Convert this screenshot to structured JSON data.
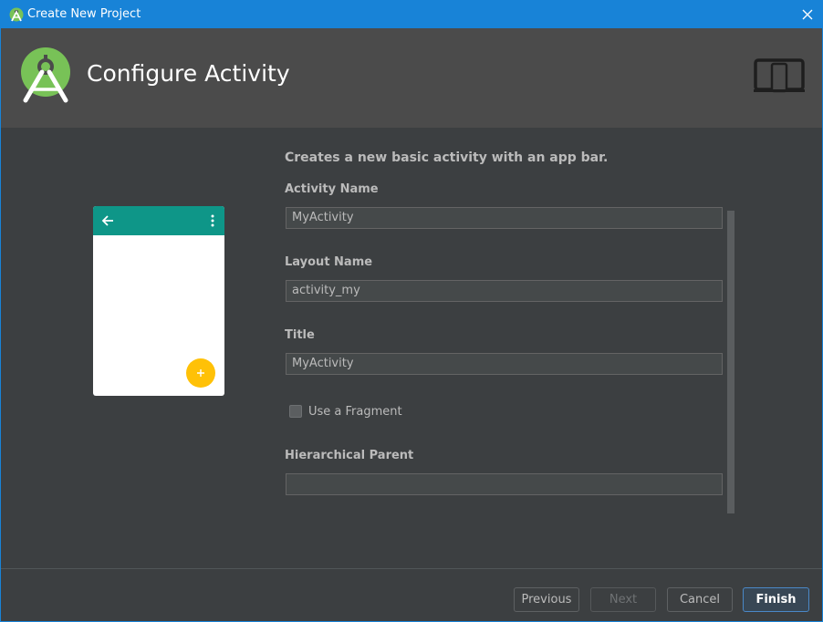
{
  "window": {
    "title": "Create New Project"
  },
  "header": {
    "heading": "Configure Activity"
  },
  "form": {
    "description": "Creates a new basic activity with an app bar.",
    "activity_name": {
      "label": "Activity Name",
      "value": "MyActivity"
    },
    "layout_name": {
      "label": "Layout Name",
      "value": "activity_my"
    },
    "title": {
      "label": "Title",
      "value": "MyActivity"
    },
    "use_fragment": {
      "label": "Use a Fragment",
      "checked": false
    },
    "hierarchical_parent": {
      "label": "Hierarchical Parent",
      "value": ""
    }
  },
  "buttons": {
    "previous": "Previous",
    "next": "Next",
    "cancel": "Cancel",
    "finish": "Finish"
  },
  "icons": {
    "app": "android-studio-icon",
    "close": "close-icon",
    "logo": "android-studio-logo",
    "device": "phone-tablet-icon",
    "back": "arrow-back-icon",
    "overflow": "more-vert-icon",
    "fab": "plus-icon"
  },
  "colors": {
    "titlebar": "#1883d7",
    "header": "#4b4b4b",
    "background": "#3c3f41",
    "app_bar": "#0e9688",
    "fab": "#ffc107",
    "primary_button_border": "#4a88c7"
  }
}
